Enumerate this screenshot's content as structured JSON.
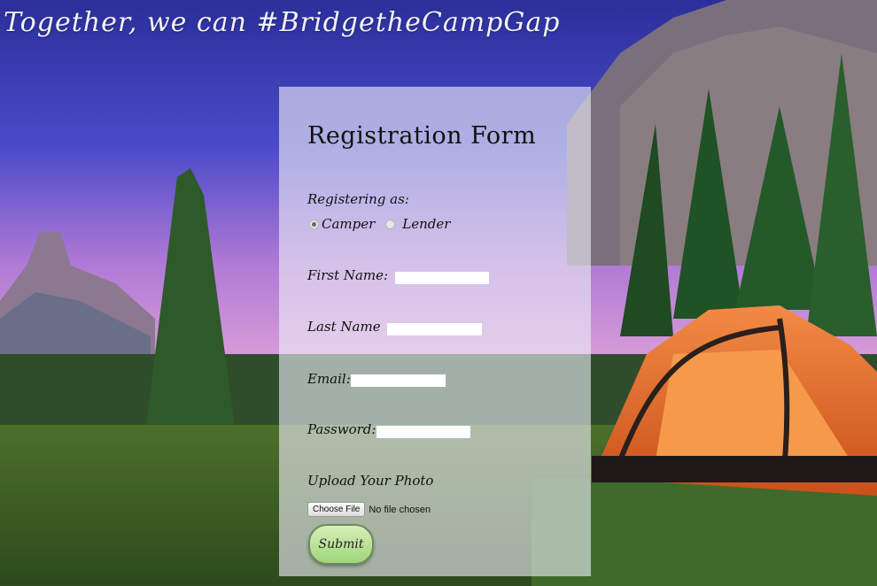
{
  "banner": {
    "text": "Together, we can #BridgetheCampGap"
  },
  "form": {
    "title": "Registration Form",
    "registering_label": "Registering as:",
    "radio_options": [
      "Camper",
      "Lender"
    ],
    "first_name_label": "First Name:",
    "last_name_label": "Last Name",
    "email_label": "Email:",
    "password_label": "Password:",
    "upload_label": "Upload Your Photo",
    "file_button_label": "Choose File",
    "file_status": "No file chosen",
    "submit_label": "Submit"
  },
  "colors": {
    "panel": "#ebeef5",
    "submit": "#9fd57a",
    "tent": "#e06a2c",
    "sky": "#4a3fb0"
  }
}
